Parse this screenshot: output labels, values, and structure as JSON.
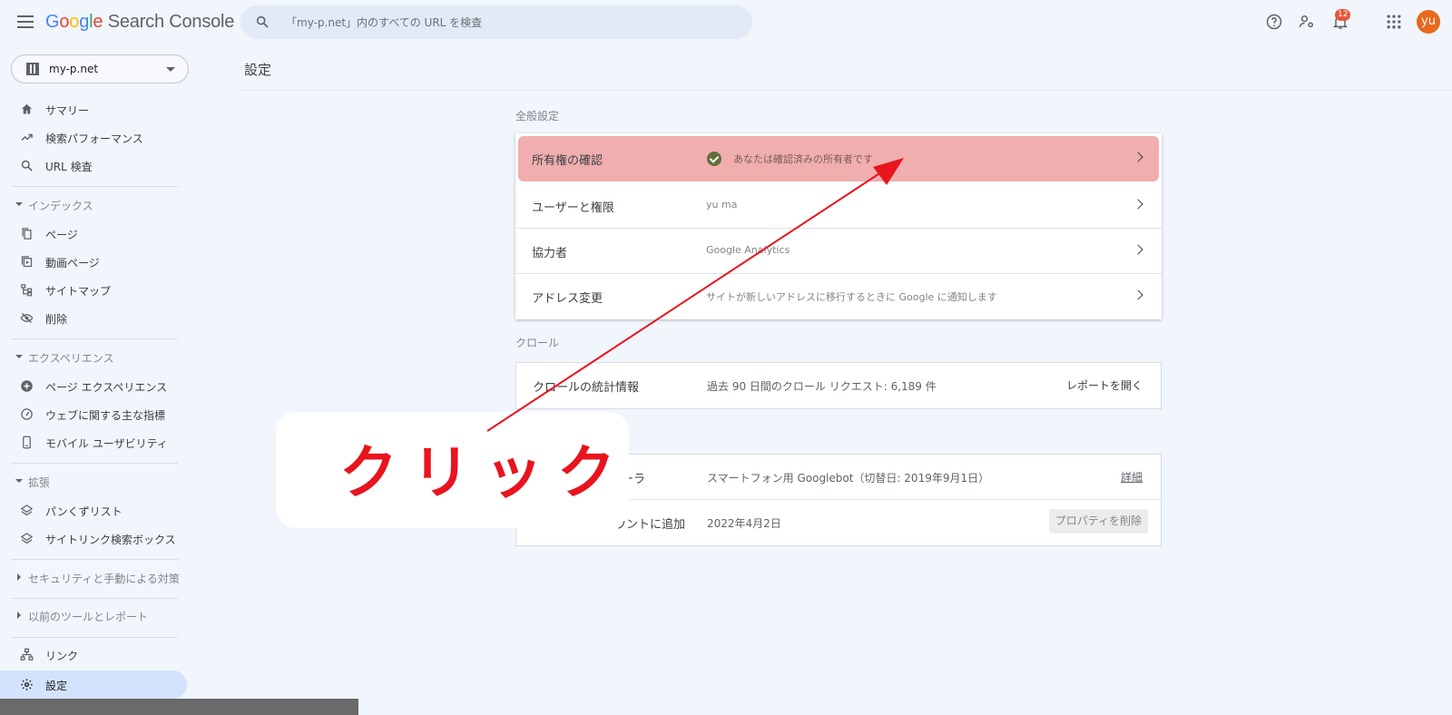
{
  "app": {
    "logo_google": [
      "G",
      "o",
      "o",
      "g",
      "l",
      "e"
    ],
    "logo_product": "Search Console"
  },
  "search": {
    "placeholder": "「my-p.net」内のすべての URL を検査"
  },
  "topbar": {
    "notifications_count": "12",
    "avatar_initials": "yu"
  },
  "sidebar": {
    "property": "my-p.net",
    "items": [
      {
        "label": "サマリー",
        "icon": "home-icon"
      },
      {
        "label": "検索パフォーマンス",
        "icon": "trending-up-icon"
      },
      {
        "label": "URL 検査",
        "icon": "search-icon"
      }
    ],
    "sections": {
      "index": {
        "label": "インデックス",
        "items": [
          "ページ",
          "動画ページ",
          "サイトマップ",
          "削除"
        ]
      },
      "experience": {
        "label": "エクスペリエンス",
        "items": [
          "ページ エクスペリエンス",
          "ウェブに関する主な指標",
          "モバイル ユーザビリティ"
        ]
      },
      "enhancements": {
        "label": "拡張",
        "items": [
          "パンくずリスト",
          "サイトリンク検索ボックス"
        ]
      },
      "security": {
        "label": "セキュリティと手動による対策"
      },
      "legacy": {
        "label": "以前のツールとレポート"
      }
    },
    "links": "リンク",
    "settings": "設定"
  },
  "main": {
    "title": "設定",
    "general": {
      "label": "全般設定",
      "rows": [
        {
          "label": "所有権の確認",
          "value": "あなたは確認済みの所有者です"
        },
        {
          "label": "ユーザーと権限",
          "value": "yu ma"
        },
        {
          "label": "協力者",
          "value": "Google Analytics"
        },
        {
          "label": "アドレス変更",
          "value": "サイトが新しいアドレスに移行するときに Google に通知します"
        }
      ]
    },
    "crawl": {
      "label": "クロール",
      "stats": {
        "label": "クロールの統計情報",
        "value": "過去 90 日間のクロール リクエスト: 6,189 件",
        "action": "レポートを開く"
      }
    },
    "about": {
      "crawler": {
        "label": "ーラ",
        "value": "スマートフォン用 Googlebot（切替日: 2019年9月1日）",
        "action": "詳細"
      },
      "added": {
        "label": "ウントに追加",
        "value": "2022年4月2日",
        "action": "プロパティを削除"
      }
    }
  },
  "annotation": {
    "text": "クリック",
    "color": "#e8141e"
  }
}
